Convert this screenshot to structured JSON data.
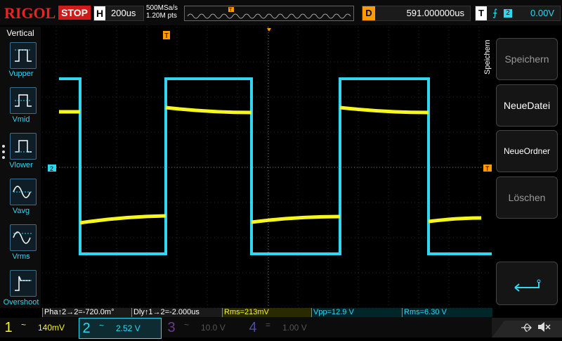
{
  "header": {
    "logo": "RIGOL",
    "run_state": "STOP",
    "timebase_key": "H",
    "timebase": "200us",
    "sample_rate": "500MSa/s",
    "memory_depth": "1.20M pts",
    "delay_key": "D",
    "delay": "591.000000us",
    "trigger_key": "T",
    "trigger_edge_icon": "rising-edge-icon",
    "trigger_source": "2",
    "trigger_level": "0.00V"
  },
  "left_menu": {
    "title": "Vertical",
    "items": [
      {
        "label": "Vupper",
        "icon": "pulse-upper-icon"
      },
      {
        "label": "Vmid",
        "icon": "pulse-mid-icon"
      },
      {
        "label": "Vlower",
        "icon": "pulse-lower-icon"
      },
      {
        "label": "Vavg",
        "icon": "sine-avg-icon"
      },
      {
        "label": "Vrms",
        "icon": "sine-rms-icon"
      },
      {
        "label": "Overshoot",
        "icon": "overshoot-icon"
      }
    ]
  },
  "right_menu": {
    "title": "Speichern",
    "buttons": [
      {
        "label": "Speichern",
        "active": false
      },
      {
        "label": "NeueDatei",
        "active": true
      },
      {
        "label": "NeueOrdner",
        "active": true
      },
      {
        "label": "Löschen",
        "active": false
      },
      {
        "label": "",
        "icon": "enter-arrow-icon",
        "active": true
      }
    ]
  },
  "grid_markers": {
    "trigger_pos_label": "T",
    "ch2_offset_label": "2",
    "trigger_level_arrow": "T"
  },
  "measurements": [
    {
      "text": "Pha↑2→2=-720.0m°",
      "color": "white"
    },
    {
      "text": "Dly↑1→2=-2.000us",
      "color": "white"
    },
    {
      "text": "Rms=213mV",
      "color": "yellow"
    },
    {
      "text": "Vpp=12.9 V",
      "color": "cyan"
    },
    {
      "text": "Rms=6.30 V",
      "color": "cyan"
    }
  ],
  "channels": [
    {
      "num": "1",
      "coupling": "~",
      "scale": "140mV",
      "color": "#f7f71f"
    },
    {
      "num": "2",
      "coupling": "~",
      "scale": "2.52 V",
      "color": "#2fd7f0"
    },
    {
      "num": "3",
      "coupling": "~",
      "scale": "10.0 V",
      "color": "#a03cff"
    },
    {
      "num": "4",
      "coupling": "=",
      "scale": "1.00 V",
      "color": "#6a6fd8"
    }
  ],
  "status_icons": [
    "usb-icon",
    "speaker-muted-icon"
  ],
  "colors": {
    "ch1": "#f7f71f",
    "ch2": "#2fd7f0",
    "trigger": "#ff9a00",
    "stop": "#d11a1a",
    "logo": "#e52424"
  }
}
